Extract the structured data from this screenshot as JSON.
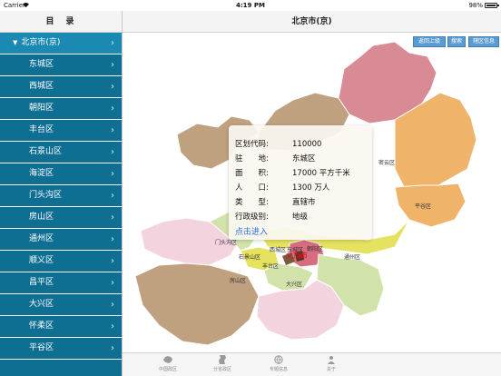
{
  "status_bar": {
    "carrier": "Carrier",
    "time": "4:19 PM",
    "battery": "98%"
  },
  "sidebar": {
    "title": "目　录",
    "province": "北京市(京)",
    "items": [
      {
        "label": "东城区"
      },
      {
        "label": "西城区"
      },
      {
        "label": "朝阳区"
      },
      {
        "label": "丰台区"
      },
      {
        "label": "石景山区"
      },
      {
        "label": "海淀区"
      },
      {
        "label": "门头沟区"
      },
      {
        "label": "房山区"
      },
      {
        "label": "通州区"
      },
      {
        "label": "顺义区"
      },
      {
        "label": "昌平区"
      },
      {
        "label": "大兴区"
      },
      {
        "label": "怀柔区"
      },
      {
        "label": "平谷区"
      }
    ]
  },
  "main": {
    "title": "北京市(京)",
    "buttons": [
      {
        "label": "返回上级"
      },
      {
        "label": "搜索"
      },
      {
        "label": "辖区信息"
      }
    ]
  },
  "map": {
    "capital": "北京市",
    "district_labels": [
      {
        "text": "密云区"
      },
      {
        "text": "平谷区"
      },
      {
        "text": "门头沟区"
      },
      {
        "text": "石景山区"
      },
      {
        "text": "西城区"
      },
      {
        "text": "东城区"
      },
      {
        "text": "朝阳区"
      },
      {
        "text": "丰台区"
      },
      {
        "text": "通州区"
      },
      {
        "text": "房山区"
      },
      {
        "text": "大兴区"
      }
    ],
    "colors": {
      "north": "#d98b95",
      "northeast": "#f0b36a",
      "center_yellow": "#e5e25f",
      "pink": "#f3d3de",
      "brown": "#bfa17f",
      "green": "#d2e2ab"
    }
  },
  "info": {
    "rows": [
      {
        "key": "区划代码:",
        "value": "110000"
      },
      {
        "key": "驻　　地:",
        "value": "东城区"
      },
      {
        "key": "面　　积:",
        "value": "17000 平方千米"
      },
      {
        "key": "人　　口:",
        "value": "1300 万人"
      },
      {
        "key": "类　　型:",
        "value": "直辖市"
      },
      {
        "key": "行政级别:",
        "value": "地级"
      }
    ],
    "link": "点击进入"
  },
  "tabs": [
    {
      "label": "中国政区",
      "icon": "china-map-icon"
    },
    {
      "label": "分省政区",
      "icon": "province-icon"
    },
    {
      "label": "专题信息",
      "icon": "globe-icon"
    },
    {
      "label": "关于",
      "icon": "about-icon"
    }
  ]
}
